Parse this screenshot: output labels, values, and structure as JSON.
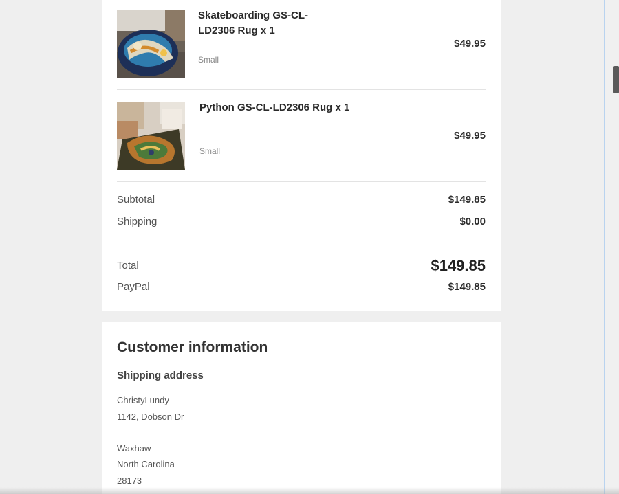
{
  "order": {
    "items": [
      {
        "title": "Skateboarding GS-CL-LD2306 Rug x 1",
        "variant": "Small",
        "price": "$49.95"
      },
      {
        "title": "Python GS-CL-LD2306 Rug x 1",
        "variant": "Small",
        "price": "$49.95"
      }
    ],
    "summary": {
      "subtotal_label": "Subtotal",
      "subtotal_value": "$149.85",
      "shipping_label": "Shipping",
      "shipping_value": "$0.00",
      "total_label": "Total",
      "total_value": "$149.85",
      "payment_label": "PayPal",
      "payment_value": "$149.85"
    }
  },
  "customer": {
    "title": "Customer information",
    "shipping_heading": "Shipping address",
    "address": {
      "name": "ChristyLundy",
      "street": "1142, Dobson Dr",
      "city": "Waxhaw",
      "state": "North Carolina",
      "zip": "28173"
    }
  },
  "colors": {
    "page_bg": "#efefef",
    "card_bg": "#ffffff",
    "text_dark": "#2a2a2a",
    "text_muted": "#8a8a8a",
    "scroll_accent": "#b9d3ef"
  }
}
